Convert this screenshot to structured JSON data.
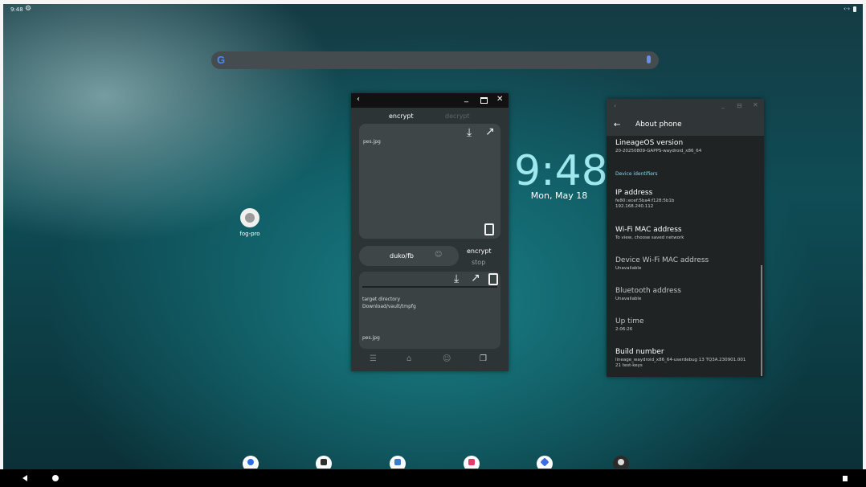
{
  "status_bar": {
    "time": "9:48",
    "settings_icon": "gear-icon",
    "right_indicator": "‹·›"
  },
  "search_bar": {
    "logo": "G",
    "mic_icon": "mic-icon"
  },
  "desktop_icons": [
    {
      "label": "fog-pro"
    }
  ],
  "clock_widget": {
    "time": "9:48",
    "date": "Mon, May 18"
  },
  "encrypt_window": {
    "tabs": {
      "encrypt": "encrypt",
      "decrypt": "decrypt"
    },
    "input_file": "pes.jpg",
    "key_field": "duko/fb",
    "encrypt_button": "encrypt",
    "stop_button": "stop",
    "target_label": "target directory",
    "target_path": "Download/vault/tmpfg",
    "output_file": "pes.jpg"
  },
  "about_window": {
    "title": "About phone",
    "items": [
      {
        "title": "LineageOS version",
        "value": "20-20250809-GAPPS-waydroid_x86_64"
      },
      {
        "title": "IP address",
        "value": "fe80::ecef:5ba4:f128:5b1b",
        "value2": "192.168.240.112"
      },
      {
        "title": "Wi-Fi MAC address",
        "value": "To view, choose saved network"
      },
      {
        "title": "Device Wi-Fi MAC address",
        "value": "Unavailable"
      },
      {
        "title": "Bluetooth address",
        "value": "Unavailable"
      },
      {
        "title": "Up time",
        "value": "2:06:26"
      },
      {
        "title": "Build number",
        "value": "lineage_waydroid_x86_64-userdebug 13 TQ3A.230901.001",
        "value2": "21 test-keys"
      }
    ],
    "section_label": "Device identifiers"
  },
  "dock": {
    "apps": [
      {
        "icon": "contacts-icon",
        "color": "#2f6ae8"
      },
      {
        "icon": "calendar-icon",
        "color": "#303030"
      },
      {
        "icon": "gallery-icon",
        "color": "#3a7ad8"
      },
      {
        "icon": "music-icon",
        "color": "#e8386a"
      },
      {
        "icon": "browser-icon",
        "color": "#3b6fe0"
      },
      {
        "icon": "camera-icon",
        "color": "#2b2b2b"
      }
    ]
  }
}
